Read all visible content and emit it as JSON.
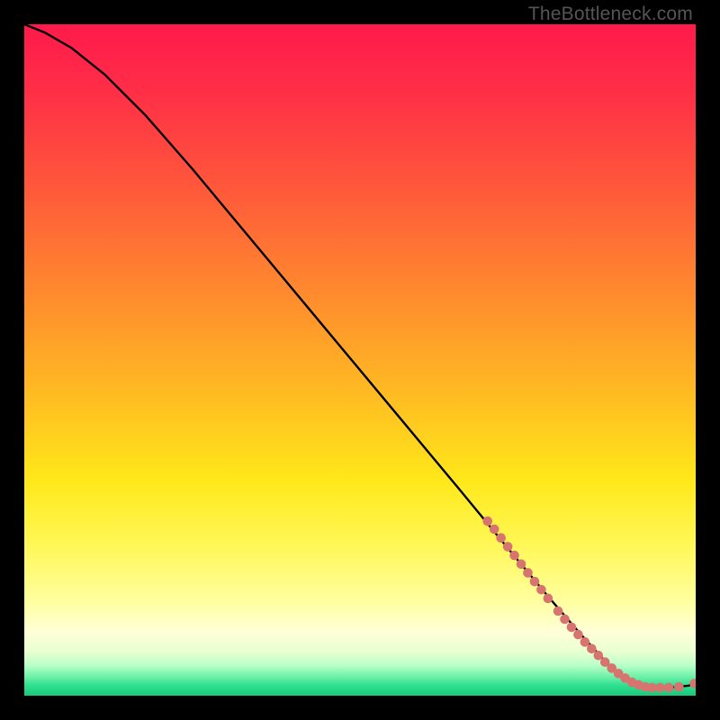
{
  "watermark": "TheBottleneck.com",
  "chart_data": {
    "type": "line",
    "title": "",
    "xlabel": "",
    "ylabel": "",
    "xlim": [
      0,
      100
    ],
    "ylim": [
      0,
      100
    ],
    "gradient_stops": [
      {
        "offset": 0.0,
        "color": "#ff1a4b"
      },
      {
        "offset": 0.1,
        "color": "#ff2e47"
      },
      {
        "offset": 0.25,
        "color": "#ff5a3a"
      },
      {
        "offset": 0.4,
        "color": "#ff8a2e"
      },
      {
        "offset": 0.55,
        "color": "#ffbb22"
      },
      {
        "offset": 0.68,
        "color": "#ffe81a"
      },
      {
        "offset": 0.78,
        "color": "#fff85a"
      },
      {
        "offset": 0.86,
        "color": "#ffffa0"
      },
      {
        "offset": 0.905,
        "color": "#ffffd8"
      },
      {
        "offset": 0.935,
        "color": "#e8ffd2"
      },
      {
        "offset": 0.955,
        "color": "#b8ffc8"
      },
      {
        "offset": 0.972,
        "color": "#6df0a8"
      },
      {
        "offset": 0.985,
        "color": "#2de08f"
      },
      {
        "offset": 1.0,
        "color": "#18c87a"
      }
    ],
    "series": [
      {
        "name": "curve",
        "x": [
          0,
          3,
          7,
          12,
          18,
          25,
          35,
          45,
          55,
          65,
          72,
          78,
          83,
          87,
          90,
          93,
          96,
          99,
          100
        ],
        "y": [
          100,
          98.8,
          96.5,
          92.5,
          86.5,
          78.5,
          66.5,
          54.5,
          42.5,
          30.5,
          22.0,
          14.8,
          9.0,
          4.6,
          2.2,
          1.2,
          1.2,
          1.5,
          2.0
        ]
      }
    ],
    "highlight_band": {
      "name": "highlight-dots",
      "color": "#d8746f",
      "points": [
        {
          "x": 69.0,
          "y": 26.0
        },
        {
          "x": 70.0,
          "y": 24.8
        },
        {
          "x": 71.0,
          "y": 23.5
        },
        {
          "x": 72.0,
          "y": 22.2
        },
        {
          "x": 73.0,
          "y": 20.9
        },
        {
          "x": 74.0,
          "y": 19.6
        },
        {
          "x": 75.0,
          "y": 18.3
        },
        {
          "x": 76.0,
          "y": 17.0
        },
        {
          "x": 77.0,
          "y": 15.8
        },
        {
          "x": 78.0,
          "y": 14.5
        },
        {
          "x": 79.5,
          "y": 12.6
        },
        {
          "x": 80.5,
          "y": 11.4
        },
        {
          "x": 81.5,
          "y": 10.2
        },
        {
          "x": 82.5,
          "y": 9.1
        },
        {
          "x": 83.5,
          "y": 8.0
        },
        {
          "x": 84.5,
          "y": 7.0
        },
        {
          "x": 85.5,
          "y": 6.0
        },
        {
          "x": 86.5,
          "y": 5.0
        },
        {
          "x": 87.5,
          "y": 4.1
        },
        {
          "x": 88.5,
          "y": 3.3
        },
        {
          "x": 89.5,
          "y": 2.6
        },
        {
          "x": 90.5,
          "y": 2.0
        },
        {
          "x": 91.5,
          "y": 1.6
        },
        {
          "x": 92.5,
          "y": 1.3
        },
        {
          "x": 93.5,
          "y": 1.2
        },
        {
          "x": 94.7,
          "y": 1.2
        },
        {
          "x": 96.0,
          "y": 1.2
        },
        {
          "x": 97.5,
          "y": 1.3
        },
        {
          "x": 99.8,
          "y": 1.8
        }
      ]
    }
  }
}
